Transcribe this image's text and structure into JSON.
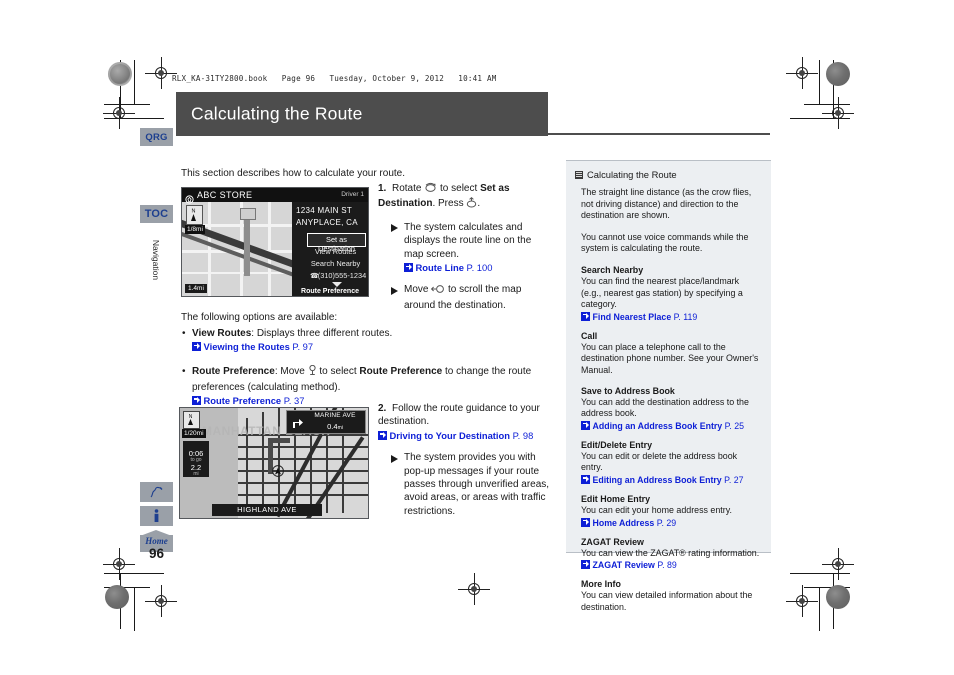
{
  "slug": "RLX_KA-31TY2800.book   Page 96   Tuesday, October 9, 2012   10:41 AM",
  "header": {
    "title": "Calculating the Route"
  },
  "sidebar": {
    "tabs": [
      {
        "label": "QRG",
        "name": "qrg"
      },
      {
        "label": "TOC",
        "name": "toc"
      }
    ],
    "vertical_label": "Navigation",
    "icons": [
      {
        "name": "pen-icon",
        "label": "Quick Reference"
      },
      {
        "name": "info-icon",
        "label": "Information"
      }
    ],
    "home_label": "Home",
    "page_number": "96"
  },
  "main": {
    "intro": "This section describes how to calculate your route.",
    "options_intro": "The following options are available:",
    "bullets": [
      {
        "title": "View Routes",
        "rest": ": Displays three different routes.",
        "ref": {
          "title": "Viewing the Routes",
          "page": "P. 97"
        }
      },
      {
        "title": "Route Preference",
        "rest_1": ": Move ",
        "rest_2": " to select ",
        "bold_2": "Route Preference",
        "rest_3": " to change the route preferences (calculating method).",
        "ref": {
          "title": "Route Preference",
          "page": "P. 37"
        }
      }
    ],
    "steps": [
      {
        "num": "1.",
        "text_1": "Rotate ",
        "text_2": " to select ",
        "bold_1": "Set as Destination",
        "text_3": ". Press ",
        "text_4": ".",
        "subs": [
          {
            "text": "The system calculates and displays the route line on the map screen.",
            "ref": {
              "title": "Route Line",
              "page": "P. 100"
            }
          },
          {
            "text_a": "Move ",
            "text_b": " to scroll the map around the destination."
          }
        ]
      },
      {
        "num": "2.",
        "text": "Follow the route guidance to your destination.",
        "ref": {
          "title": "Driving to Your Destination",
          "page": "P. 98"
        },
        "subs": [
          {
            "text": "The system provides you with pop-up messages if your route passes through unverified areas, avoid areas, or areas with traffic restrictions."
          }
        ]
      }
    ]
  },
  "screenshot_one": {
    "title": "ABC STORE",
    "driver": "Driver 1",
    "address_line1": "1234 MAIN ST",
    "address_line2": "ANYPLACE, CA",
    "scale_top": "1/8mi",
    "scale_bottom": "1.4mi",
    "menu": [
      {
        "label": "Set as Destination",
        "selected": true
      },
      {
        "label": "View Routes",
        "selected": false
      },
      {
        "label": "Search Nearby",
        "selected": false
      },
      {
        "label": "(310)555-1234",
        "selected": false,
        "phone": true
      }
    ],
    "footer": "Route Preference"
  },
  "screenshot_two": {
    "street_label": "MARINE AVE",
    "distance": "0.4",
    "distance_unit": "mi",
    "scale": "1/20mi",
    "eta": "0:06",
    "eta_unit": "to go",
    "remaining": "2.2",
    "remaining_unit": "mi",
    "area_label": "MANHATTAN BEACH",
    "bottom_street": "HIGHLAND AVE"
  },
  "panel": {
    "heading": "Calculating the Route",
    "paragraphs": [
      "The straight line distance (as the crow flies, not driving distance) and direction to the destination are shown.",
      "You cannot use voice commands while the system is calculating the route."
    ],
    "sections": [
      {
        "title": "Search Nearby",
        "desc": "You can find the nearest place/landmark (e.g., nearest gas station) by specifying a category.",
        "ref": {
          "title": "Find Nearest Place",
          "page": "P. 119"
        }
      },
      {
        "title": "Call",
        "desc": "You can place a telephone call to the destination phone number. See your Owner's Manual.",
        "ref": null
      },
      {
        "title": "Save to Address Book",
        "desc": "You can add the destination address to the address book.",
        "ref": {
          "title": "Adding an Address Book Entry",
          "page": "P. 25"
        }
      },
      {
        "title": "Edit/Delete Entry",
        "desc": "You can edit or delete the address book entry.",
        "ref": {
          "title": "Editing an Address Book Entry",
          "page": "P. 27"
        }
      },
      {
        "title": "Edit Home Entry",
        "desc": "You can edit your home address entry.",
        "ref": {
          "title": "Home Address",
          "page": "P. 29"
        }
      },
      {
        "title": "ZAGAT Review",
        "desc": "You can view the ZAGAT® rating information.",
        "ref": {
          "title": "ZAGAT Review",
          "page": "P. 89"
        }
      },
      {
        "title": "More Info",
        "desc": "You can view detailed information about the destination.",
        "ref": null
      }
    ]
  },
  "colors": {
    "header_bar": "#4d4d4d",
    "tab_gray": "#9aa0a8",
    "tab_blue": "#1d3f8f",
    "link_blue": "#0d1fd6",
    "panel_bg": "#eceff2"
  }
}
